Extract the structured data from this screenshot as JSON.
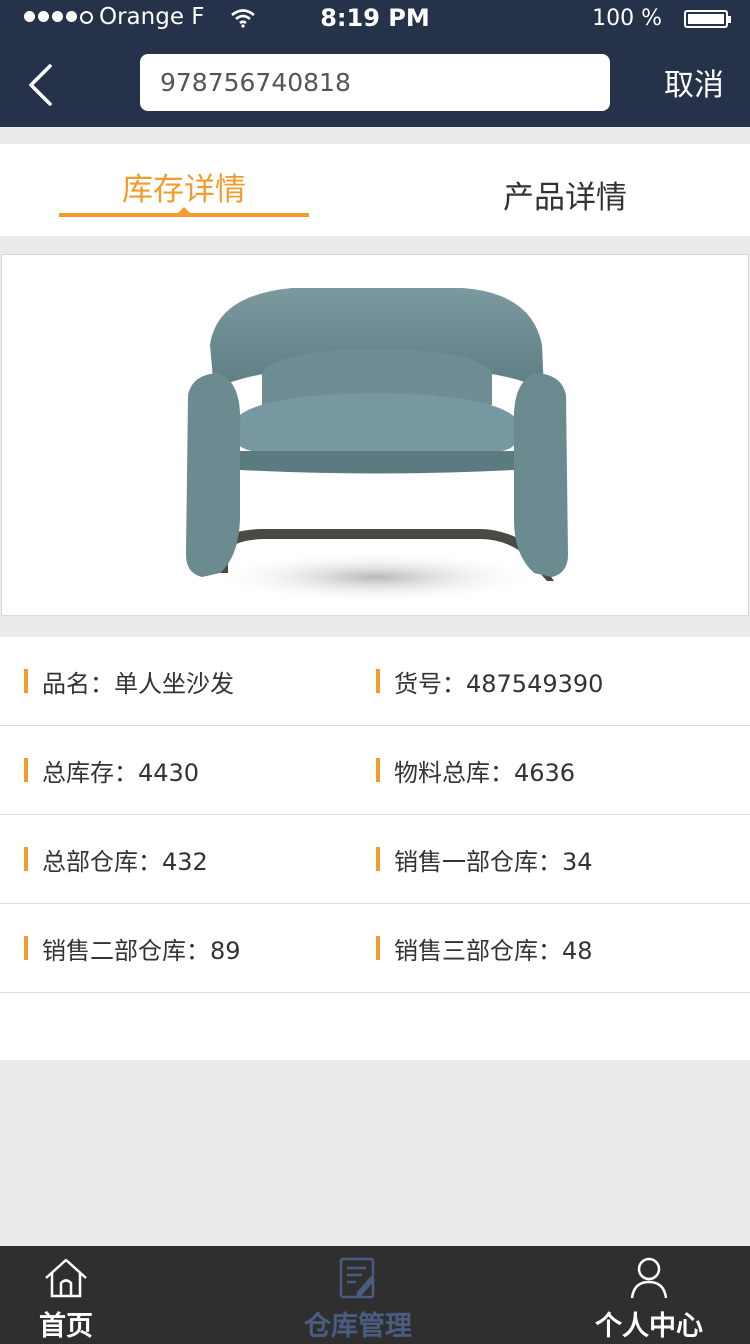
{
  "status_bar": {
    "carrier": "Orange F",
    "time": "8:19 PM",
    "battery": "100 %"
  },
  "header": {
    "search_value": "978756740818",
    "cancel_label": "取消"
  },
  "tabs": [
    {
      "label": "库存详情",
      "active": true
    },
    {
      "label": "产品详情",
      "active": false
    }
  ],
  "product": {
    "image": "armchair-photo"
  },
  "details": [
    {
      "left": "品名：单人坐沙发",
      "right": "货号：487549390"
    },
    {
      "left": "总库存：4430",
      "right": "物料总库：4636"
    },
    {
      "left": "总部仓库：432",
      "right": "销售一部仓库：34"
    },
    {
      "left": "销售二部仓库：89",
      "right": "销售三部仓库：48"
    }
  ],
  "tabbar": {
    "items": [
      {
        "label": "首页",
        "icon": "home-icon",
        "active": false
      },
      {
        "label": "仓库管理",
        "icon": "inventory-icon",
        "active": true
      },
      {
        "label": "个人中心",
        "icon": "user-icon",
        "active": false
      }
    ]
  },
  "colors": {
    "header_bg": "#25324a",
    "accent": "#f39b2e",
    "tabbar_bg": "#2f2f2f",
    "tabbar_active": "#4a5d80"
  }
}
